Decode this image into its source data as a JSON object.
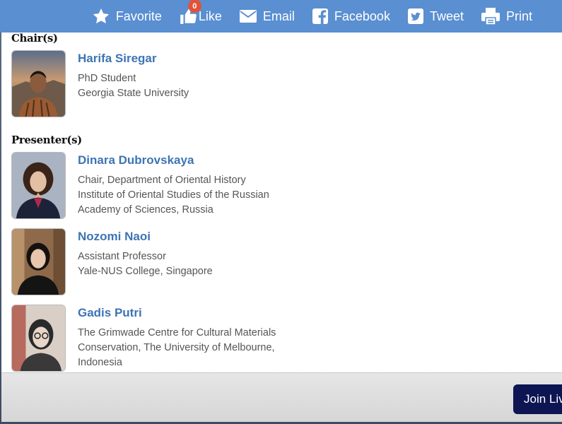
{
  "toolbar": {
    "favorite_label": "Favorite",
    "like_label": "Like",
    "like_count": "0",
    "email_label": "Email",
    "facebook_label": "Facebook",
    "tweet_label": "Tweet",
    "print_label": "Print",
    "background_color": "#5a8fd1",
    "badge_color": "#e0533a"
  },
  "chairs": {
    "heading": "Chair(s)",
    "people": [
      {
        "name": "Harifa Siregar",
        "lines": [
          "PhD Student",
          "Georgia State University"
        ]
      }
    ]
  },
  "presenters": {
    "heading": "Presenter(s)",
    "people": [
      {
        "name": "Dinara Dubrovskaya",
        "lines": [
          "Chair, Department of Oriental History",
          "Institute of Oriental Studies of the Russian",
          "Academy of Sciences, Russia"
        ]
      },
      {
        "name": "Nozomi Naoi",
        "lines": [
          "Assistant Professor",
          "Yale-NUS College, Singapore"
        ]
      },
      {
        "name": "Gadis Putri",
        "lines": [
          "The Grimwade Centre for Cultural Materials",
          "Conservation, The University of Melbourne,",
          "Indonesia"
        ]
      }
    ]
  },
  "footer": {
    "join_label": "Join Live",
    "join_color": "#0d1553"
  },
  "colors": {
    "name_link": "#3d74b4",
    "detail_text": "#555555"
  }
}
